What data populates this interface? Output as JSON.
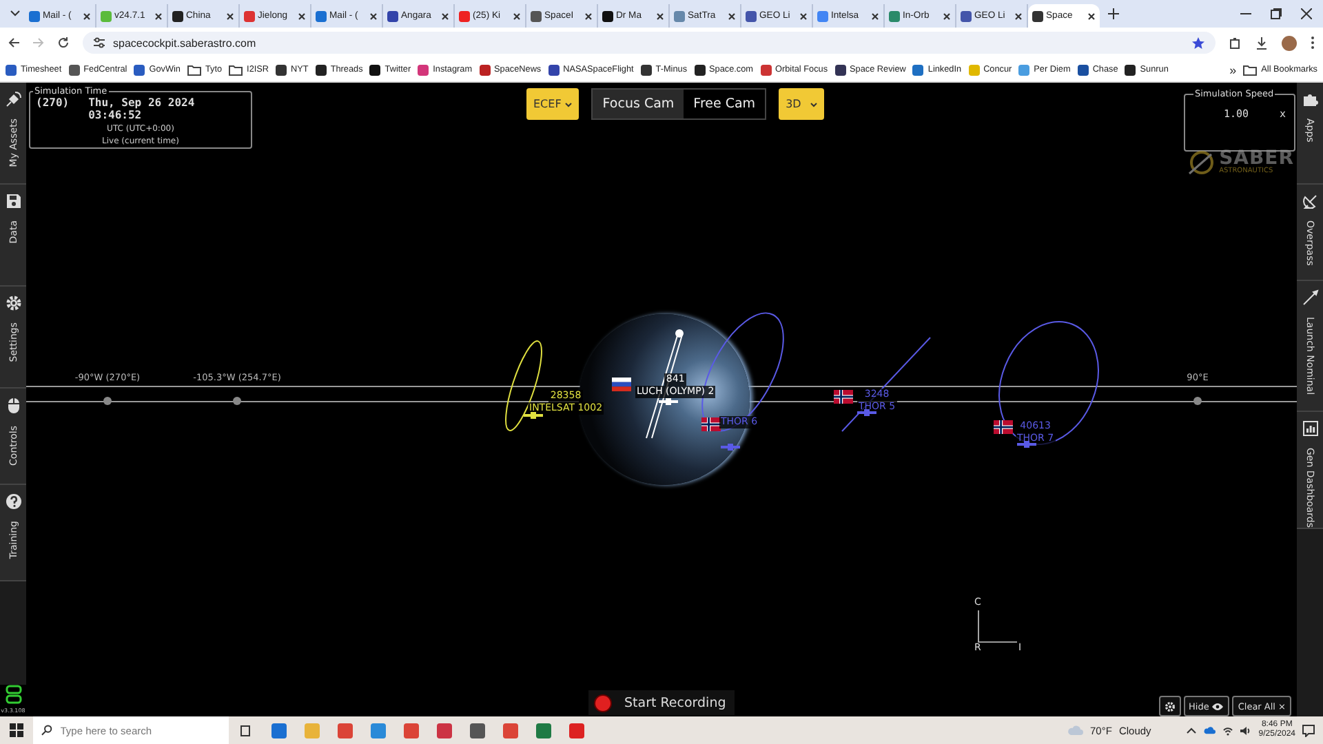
{
  "browser": {
    "tabs": [
      {
        "label": "Mail - (",
        "selected": false
      },
      {
        "label": "v24.7.1",
        "selected": false
      },
      {
        "label": "China",
        "selected": false
      },
      {
        "label": "Jielong",
        "selected": false
      },
      {
        "label": "Mail - (",
        "selected": false
      },
      {
        "label": "Angara",
        "selected": false
      },
      {
        "label": "(25) Ki",
        "selected": false
      },
      {
        "label": "SpaceI",
        "selected": false
      },
      {
        "label": "Dr Ma",
        "selected": false
      },
      {
        "label": "SatTra",
        "selected": false
      },
      {
        "label": "GEO Li",
        "selected": false
      },
      {
        "label": "Intelsa",
        "selected": false
      },
      {
        "label": "In-Orb",
        "selected": false
      },
      {
        "label": "GEO Li",
        "selected": false
      },
      {
        "label": "Space",
        "selected": true
      }
    ],
    "url": "spacecockpit.saberastro.com",
    "bookmarks": [
      {
        "label": "Timesheet",
        "kind": "link"
      },
      {
        "label": "FedCentral",
        "kind": "link"
      },
      {
        "label": "GovWin",
        "kind": "link"
      },
      {
        "label": "Tyto",
        "kind": "folder"
      },
      {
        "label": "I2ISR",
        "kind": "folder"
      },
      {
        "label": "NYT",
        "kind": "link"
      },
      {
        "label": "Threads",
        "kind": "link"
      },
      {
        "label": "Twitter",
        "kind": "link"
      },
      {
        "label": "Instagram",
        "kind": "link"
      },
      {
        "label": "SpaceNews",
        "kind": "link"
      },
      {
        "label": "NASASpaceFlight",
        "kind": "link"
      },
      {
        "label": "T-Minus",
        "kind": "link"
      },
      {
        "label": "Space.com",
        "kind": "link"
      },
      {
        "label": "Orbital Focus",
        "kind": "link"
      },
      {
        "label": "Space Review",
        "kind": "link"
      },
      {
        "label": "LinkedIn",
        "kind": "link"
      },
      {
        "label": "Concur",
        "kind": "link"
      },
      {
        "label": "Per Diem",
        "kind": "link"
      },
      {
        "label": "Chase",
        "kind": "link"
      },
      {
        "label": "Sunrun",
        "kind": "link"
      }
    ],
    "more_bookmarks": "»",
    "all_bookmarks": "All Bookmarks"
  },
  "left_sidebar": {
    "items": [
      {
        "label": "My Assets",
        "kind": "satellite"
      },
      {
        "label": "Data",
        "kind": "save"
      },
      {
        "label": "Settings",
        "kind": "gear"
      },
      {
        "label": "Controls",
        "kind": "mouse"
      },
      {
        "label": "Training",
        "kind": "help"
      }
    ]
  },
  "right_sidebar": {
    "items": [
      {
        "label": "Apps",
        "kind": "puzzle"
      },
      {
        "label": "Overpass",
        "kind": "dish"
      },
      {
        "label": "Launch Nominal",
        "kind": "rocket"
      },
      {
        "label": "Gen Dashboards",
        "kind": "chart"
      }
    ]
  },
  "simulation_time": {
    "title": "Simulation Time",
    "day": "(270)",
    "datetime": "Thu, Sep 26 2024 03:46:52",
    "timezone": "UTC (UTC+0:00)",
    "mode": "Live (current time)"
  },
  "toolbar": {
    "frame": "ECEF",
    "cameras": [
      {
        "label": "Focus Cam",
        "selected": true
      },
      {
        "label": "Free Cam",
        "selected": false
      }
    ],
    "view": "3D"
  },
  "simulation_speed": {
    "title": "Simulation Speed",
    "value": "1.00",
    "unit": "x"
  },
  "logo": {
    "name": "SABER",
    "tagline": "ASTRONAUTICS"
  },
  "grid_labels": [
    "-90°W (270°E)",
    "-105.3°W (254.7°E)",
    "90°E"
  ],
  "satellites": [
    {
      "id": "28358",
      "name": "INTELSAT 1002",
      "color": "#e0e040",
      "kind": "plain"
    },
    {
      "id": "841",
      "name": "LUCH (OLYMP) 2",
      "color": "#ffffff",
      "kind": "russian"
    },
    {
      "name": "THOR 6",
      "color": "#5a5ae6",
      "kind": "norwegian"
    },
    {
      "id": "3248",
      "name": "THOR 5",
      "color": "#5a5ae6",
      "kind": "norwegian"
    },
    {
      "id": "40613",
      "name": "THOR 7",
      "color": "#5a5ae6",
      "kind": "norwegian"
    }
  ],
  "axes": [
    "C",
    "R",
    "I"
  ],
  "record_button": "Start Recording",
  "view_controls": {
    "hide": "Hide",
    "clear": "Clear All ×"
  },
  "version": "v3.3.108",
  "taskbar": {
    "search_placeholder": "Type here to search",
    "temperature": "70°F",
    "condition": "Cloudy",
    "time": "8:46 PM",
    "date": "9/25/2024"
  }
}
